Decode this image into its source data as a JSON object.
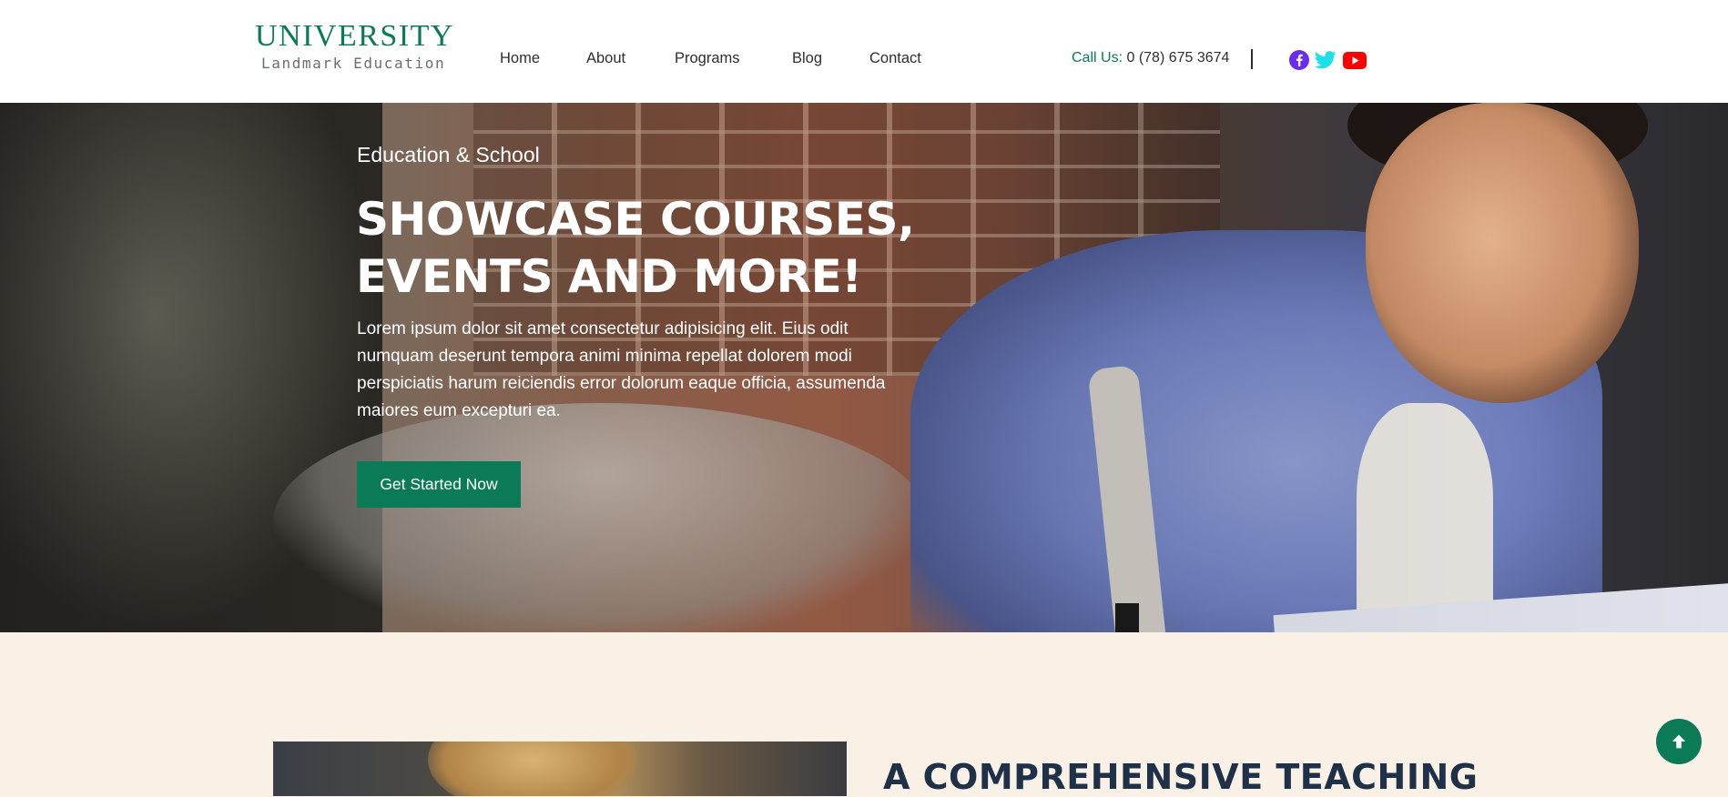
{
  "header": {
    "logo_main": "UNIVERSITY",
    "logo_sub": "Landmark Education",
    "nav": [
      "Home",
      "About",
      "Programs",
      "Blog",
      "Contact"
    ],
    "call_label": "Call Us:",
    "call_number": "0 (78) 675 3674",
    "social": [
      {
        "icon": "facebook-icon",
        "color": "#6a2cf0"
      },
      {
        "icon": "twitter-icon",
        "color": "#1ee0e8"
      },
      {
        "icon": "youtube-icon",
        "color": "#ff0000"
      }
    ]
  },
  "hero": {
    "eyebrow": "Education & School",
    "title_line1": "SHOWCASE COURSES,",
    "title_line2": "EVENTS AND MORE!",
    "text": "Lorem ipsum dolor sit amet consectetur adipisicing elit. Eius odit numquam deserunt tempora animi minima repellat dolorem modi perspiciatis harum reiciendis error dolorum eaque officia, assumenda maiores eum excepturi ea.",
    "cta": "Get Started Now"
  },
  "section": {
    "title": "A COMPREHENSIVE TEACHING"
  },
  "colors": {
    "brand": "#0b7a57",
    "text_dark": "#2b2f33",
    "section_bg": "#faf1e6",
    "heading_navy": "#1f3148"
  }
}
